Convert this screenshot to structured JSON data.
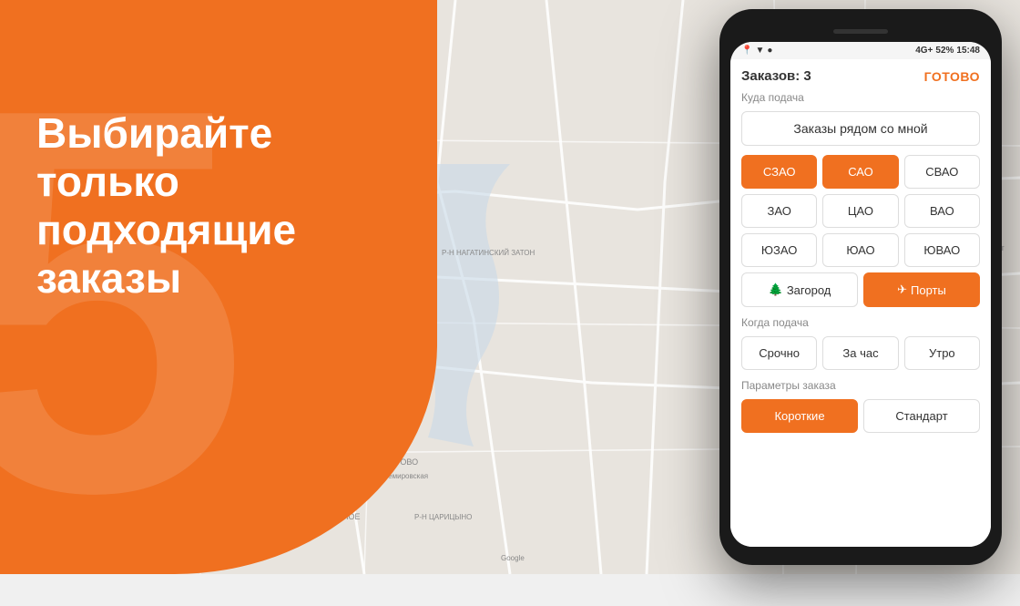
{
  "background": {
    "orange_color": "#F07020",
    "map_color": "#e8e4de",
    "deco_number": "5"
  },
  "left": {
    "title_line1": "Выбирайте только",
    "title_line2": "подходящие заказы"
  },
  "phone": {
    "status_bar": {
      "location_icon": "📍",
      "signal": "▼▲",
      "network": "4G+",
      "battery": "52%",
      "time": "15:48"
    },
    "header": {
      "orders_count_label": "Заказов: 3",
      "ready_button": "ГОТОВО"
    },
    "pickup_section": {
      "label": "Куда подача",
      "nearby_button": "Заказы рядом со мной"
    },
    "districts": [
      {
        "label": "СЗАО",
        "active": true
      },
      {
        "label": "САО",
        "active": true
      },
      {
        "label": "СВАО",
        "active": false
      },
      {
        "label": "ЗАО",
        "active": false
      },
      {
        "label": "ЦАО",
        "active": false
      },
      {
        "label": "ВАО",
        "active": false
      },
      {
        "label": "ЮЗАО",
        "active": false
      },
      {
        "label": "ЮАО",
        "active": false
      },
      {
        "label": "ЮВАО",
        "active": false
      }
    ],
    "special_buttons": [
      {
        "label": "🌲 Загород",
        "active": false
      },
      {
        "label": "✈ Порты",
        "active": true
      }
    ],
    "when_section": {
      "label": "Когда подача",
      "buttons": [
        {
          "label": "Срочно",
          "active": false
        },
        {
          "label": "За час",
          "active": false
        },
        {
          "label": "Утро",
          "active": false
        }
      ]
    },
    "params_section": {
      "label": "Параметры заказа",
      "buttons": [
        {
          "label": "Короткие",
          "active": true
        },
        {
          "label": "Стандарт",
          "active": false
        }
      ]
    }
  }
}
